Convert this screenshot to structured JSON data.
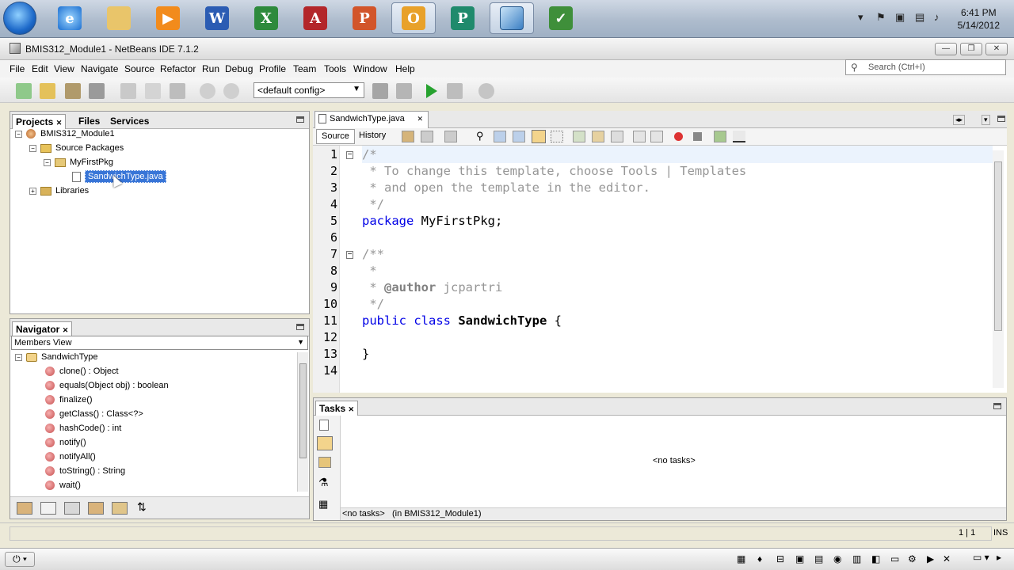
{
  "taskbar": {
    "apps": [
      "internet-explorer",
      "file-explorer",
      "media-player",
      "word",
      "excel",
      "access",
      "powerpoint",
      "outlook",
      "publisher",
      "netbeans",
      "project"
    ],
    "clock_time": "6:41 PM",
    "clock_date": "5/14/2012"
  },
  "window": {
    "title": "BMIS312_Module1 - NetBeans IDE 7.1.2"
  },
  "menu": [
    "File",
    "Edit",
    "View",
    "Navigate",
    "Source",
    "Refactor",
    "Run",
    "Debug",
    "Profile",
    "Team",
    "Tools",
    "Window",
    "Help"
  ],
  "search": {
    "placeholder": "Search (Ctrl+I)"
  },
  "toolbar": {
    "config": "<default config>"
  },
  "projects_panel": {
    "tabs": [
      "Projects",
      "Files",
      "Services"
    ],
    "tree": {
      "project": "BMIS312_Module1",
      "source_packages": "Source Packages",
      "package": "MyFirstPkg",
      "file": "SandwichType.java",
      "libraries": "Libraries"
    }
  },
  "navigator": {
    "title": "Navigator",
    "view": "Members View",
    "root": "SandwichType",
    "members": [
      "clone() : Object",
      "equals(Object obj) : boolean",
      "finalize()",
      "getClass() : Class<?>",
      "hashCode() : int",
      "notify()",
      "notifyAll()",
      "toString() : String",
      "wait()"
    ]
  },
  "editor": {
    "tab": "SandwichType.java",
    "source_tab": "Source",
    "history_tab": "History",
    "line_numbers": [
      "1",
      "2",
      "3",
      "4",
      "5",
      "6",
      "7",
      "8",
      "9",
      "10",
      "11",
      "12",
      "13",
      "14"
    ]
  },
  "code": {
    "l1": "/*",
    "l2": " * To change this template, choose Tools | Templates",
    "l3": " * and open the template in the editor.",
    "l4": " */",
    "l5_kw": "package",
    "l5_rest": " MyFirstPkg;",
    "l7": "/**",
    "l8": " *",
    "l9_a": " * ",
    "l9_tag": "@author",
    "l9_b": " jcpartri",
    "l10": " */",
    "l11_kw": "public class",
    "l11_name": " SandwichType",
    "l11_rest": " {",
    "l13": "}"
  },
  "tasks": {
    "title": "Tasks",
    "empty": "<no tasks>",
    "status_a": "<no tasks>",
    "status_b": "(in BMIS312_Module1)"
  },
  "status": {
    "position": "1 | 1",
    "mode": "INS"
  },
  "colors": {
    "comment": "#969696",
    "keyword": "#0000e6",
    "selection": "#3875d7"
  }
}
